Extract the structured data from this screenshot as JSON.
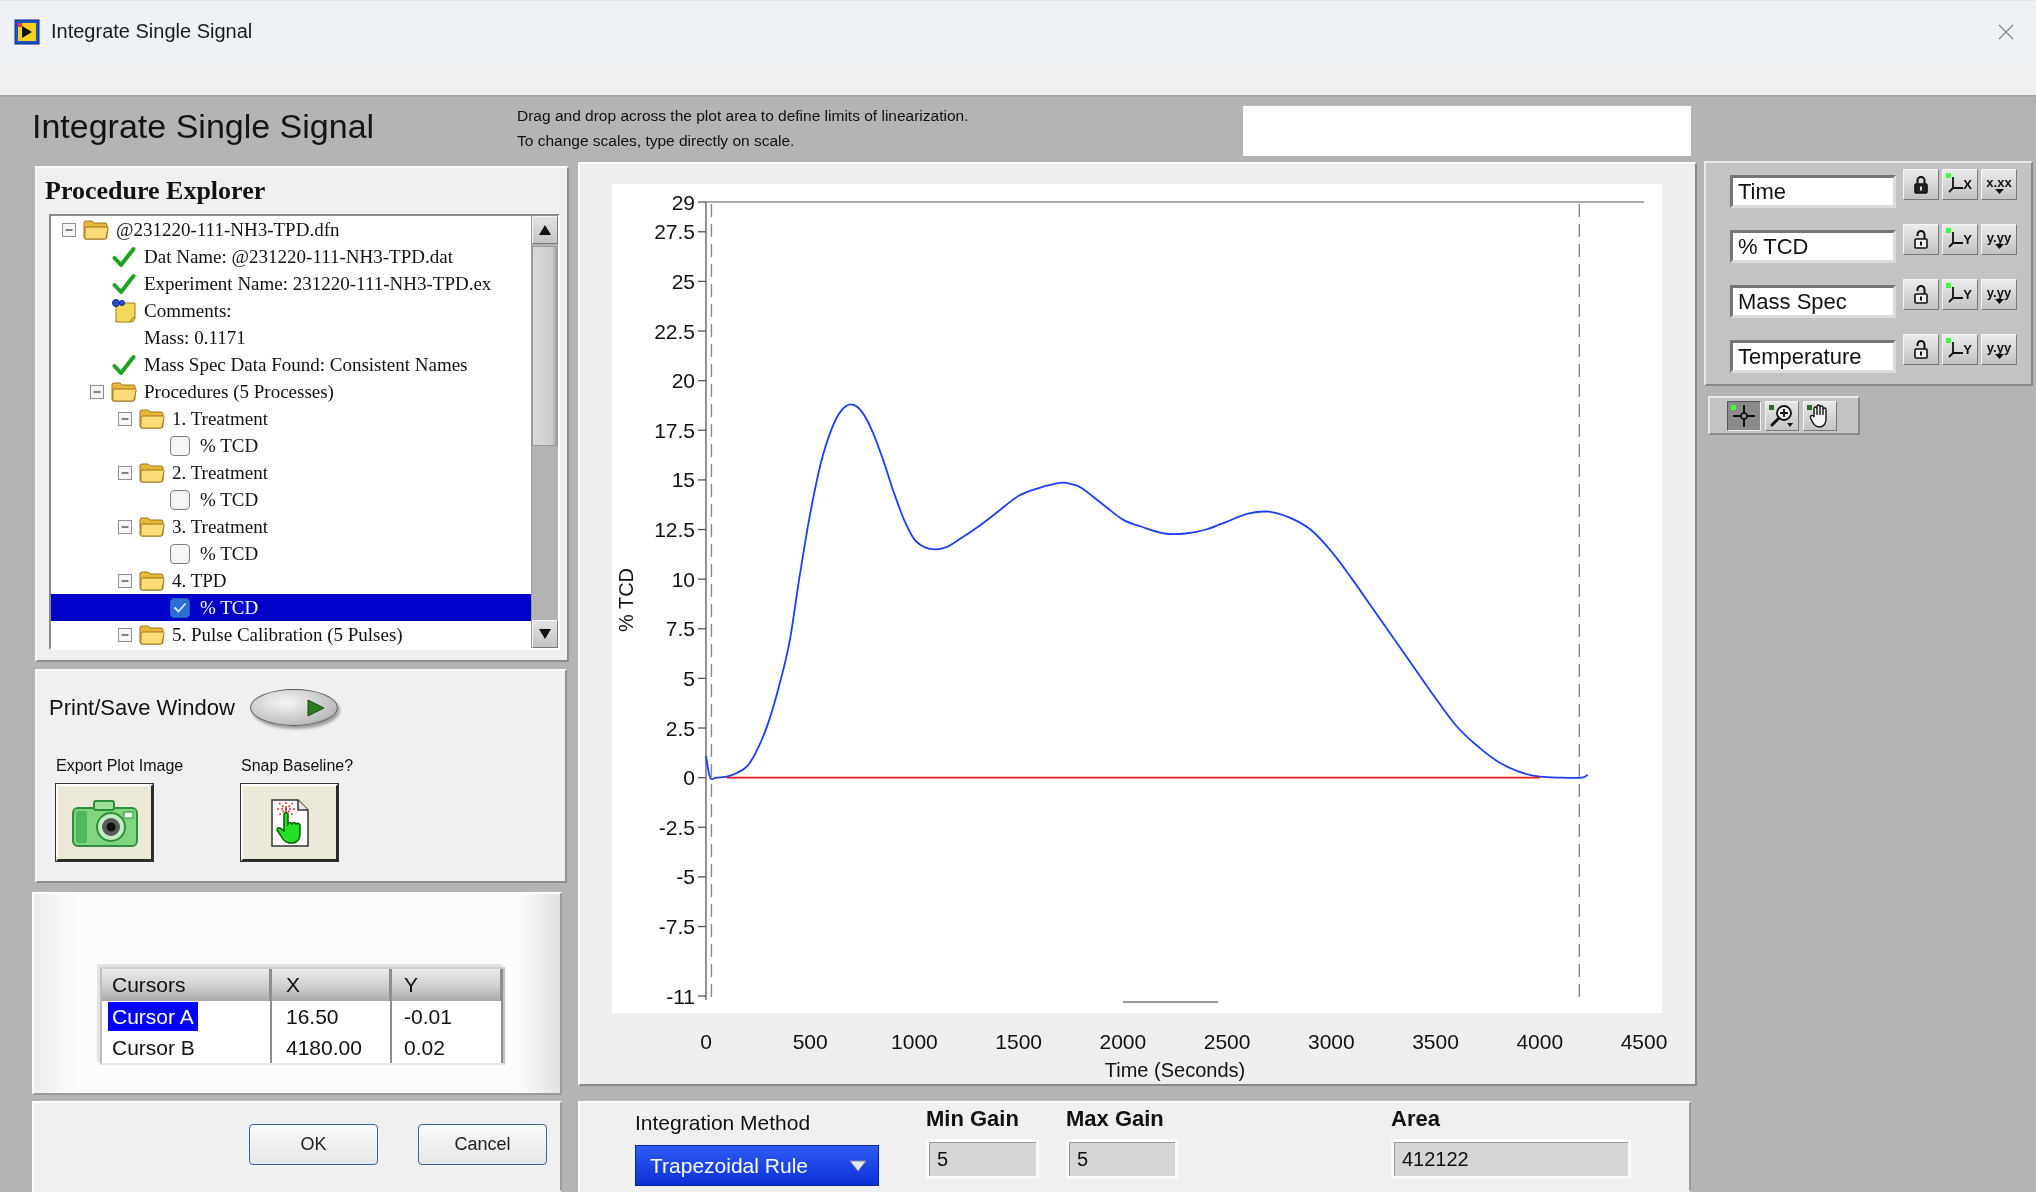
{
  "window": {
    "title": "Integrate Single Signal"
  },
  "header": {
    "title": "Integrate Single Signal",
    "instructions": [
      "Drag and drop across the plot area to define limits of linearization.",
      "To change scales, type directly on scale."
    ]
  },
  "procedure_explorer": {
    "title": "Procedure Explorer",
    "tree": [
      {
        "kind": "folder",
        "label": "@231220-111-NH3-TPD.dfn",
        "expanded": true,
        "selected": false,
        "children": [
          {
            "kind": "check",
            "label": "Dat Name: @231220-111-NH3-TPD.dat",
            "selected": false
          },
          {
            "kind": "check",
            "label": "Experiment Name: 231220-111-NH3-TPD.ex",
            "selected": false
          },
          {
            "kind": "comment",
            "label": "Comments:",
            "detail": "Mass: 0.1171",
            "selected": false
          },
          {
            "kind": "check",
            "label": "Mass Spec Data Found: Consistent Names",
            "selected": false
          },
          {
            "kind": "folder",
            "label": "Procedures (5 Processes)",
            "expanded": true,
            "selected": false,
            "children": [
              {
                "kind": "folder",
                "label": "1. Treatment",
                "expanded": true,
                "selected": false,
                "children": [
                  {
                    "kind": "checkbox",
                    "label": "% TCD",
                    "checked": false,
                    "selected": false
                  }
                ]
              },
              {
                "kind": "folder",
                "label": "2. Treatment",
                "expanded": true,
                "selected": false,
                "children": [
                  {
                    "kind": "checkbox",
                    "label": "% TCD",
                    "checked": false,
                    "selected": false
                  }
                ]
              },
              {
                "kind": "folder",
                "label": "3. Treatment",
                "expanded": true,
                "selected": false,
                "children": [
                  {
                    "kind": "checkbox",
                    "label": "% TCD",
                    "checked": false,
                    "selected": false
                  }
                ]
              },
              {
                "kind": "folder",
                "label": "4. TPD",
                "expanded": true,
                "selected": false,
                "children": [
                  {
                    "kind": "checkbox",
                    "label": "% TCD",
                    "checked": true,
                    "selected": true
                  }
                ]
              },
              {
                "kind": "folder",
                "label": "5. Pulse Calibration (5 Pulses)",
                "expanded": true,
                "selected": false
              }
            ]
          }
        ]
      }
    ]
  },
  "print_save": {
    "label": "Print/Save Window"
  },
  "actions": [
    {
      "kind": "export",
      "label": "Export Plot Image"
    },
    {
      "kind": "snap",
      "label": "Snap Baseline?"
    }
  ],
  "cursor_table": {
    "columns": [
      "Cursors",
      "X",
      "Y"
    ],
    "rows": [
      {
        "cells": [
          "Cursor A",
          "16.50",
          "-0.01"
        ],
        "selected": true
      },
      {
        "cells": [
          "Cursor B",
          "4180.00",
          "0.02"
        ],
        "selected": false
      }
    ]
  },
  "buttons": [
    "OK",
    "Cancel"
  ],
  "plot": {
    "chart_data": {
      "type": "line",
      "xlabel": "Time (Seconds)",
      "ylabel": "% TCD",
      "x": [
        0,
        20,
        50,
        100,
        150,
        200,
        250,
        300,
        350,
        400,
        450,
        500,
        550,
        600,
        650,
        700,
        750,
        800,
        850,
        900,
        950,
        1000,
        1050,
        1100,
        1150,
        1200,
        1300,
        1400,
        1500,
        1600,
        1700,
        1750,
        1800,
        1900,
        2000,
        2100,
        2200,
        2300,
        2400,
        2500,
        2600,
        2700,
        2800,
        2900,
        3000,
        3100,
        3200,
        3300,
        3400,
        3500,
        3600,
        3700,
        3800,
        3900,
        4000,
        4100,
        4200,
        4230
      ],
      "series": [
        {
          "color": "#1c3ff0",
          "values": [
            1.1,
            0,
            0,
            0.05,
            0.25,
            0.6,
            1.5,
            2.8,
            4.6,
            6.8,
            10.2,
            13.3,
            15.8,
            17.5,
            18.5,
            18.8,
            18.4,
            17.4,
            16.0,
            14.4,
            13.0,
            12.0,
            11.6,
            11.5,
            11.6,
            11.9,
            12.6,
            13.4,
            14.2,
            14.6,
            14.85,
            14.8,
            14.6,
            13.8,
            13.0,
            12.6,
            12.3,
            12.3,
            12.5,
            12.9,
            13.3,
            13.4,
            13.1,
            12.5,
            11.4,
            10.0,
            8.5,
            7.0,
            5.5,
            4.0,
            2.6,
            1.6,
            0.8,
            0.3,
            0.05,
            0,
            0,
            0.15
          ]
        },
        {
          "color": "#ee1c1c",
          "values": [
            null,
            null,
            null,
            0,
            0,
            0,
            0,
            0,
            0,
            0,
            0,
            0,
            0,
            0,
            0,
            0,
            0,
            0,
            0,
            0,
            0,
            0,
            0,
            0,
            0,
            0,
            0,
            0,
            0,
            0,
            0,
            0,
            0,
            0,
            0,
            0,
            0,
            0,
            0,
            0,
            0,
            0,
            0,
            0,
            0,
            0,
            0,
            0,
            0,
            0,
            0,
            0,
            0,
            0,
            0,
            null,
            null,
            null
          ]
        }
      ],
      "xlim": [
        0,
        4500
      ],
      "ylim": [
        -11,
        29
      ],
      "xticks": [
        0,
        500,
        1000,
        1500,
        2000,
        2500,
        3000,
        3500,
        4000,
        4500
      ],
      "yticks": [
        29,
        27.5,
        25,
        22.5,
        20,
        17.5,
        15,
        12.5,
        10,
        7.5,
        5,
        2.5,
        0,
        -2.5,
        -5,
        -7.5,
        -11
      ]
    }
  },
  "integration": {
    "method_label": "Integration Method",
    "method": "Trapezoidal Rule",
    "min_gain_label": "Min Gain",
    "min_gain": "5",
    "max_gain_label": "Max Gain",
    "max_gain": "5",
    "area_label": "Area",
    "area": "412122"
  },
  "scales": [
    {
      "name": "Time",
      "locked": true,
      "axis": "X",
      "format": "x.xx"
    },
    {
      "name": "% TCD",
      "locked": false,
      "axis": "Y",
      "format": "y.yy"
    },
    {
      "name": "Mass Spec",
      "locked": false,
      "axis": "Y",
      "format": "y.yy"
    },
    {
      "name": "Temperature",
      "locked": false,
      "axis": "Y",
      "format": "y.yy"
    }
  ],
  "tools": [
    {
      "kind": "cursor",
      "selected": true
    },
    {
      "kind": "zoom",
      "selected": false
    },
    {
      "kind": "pan",
      "selected": false
    }
  ]
}
